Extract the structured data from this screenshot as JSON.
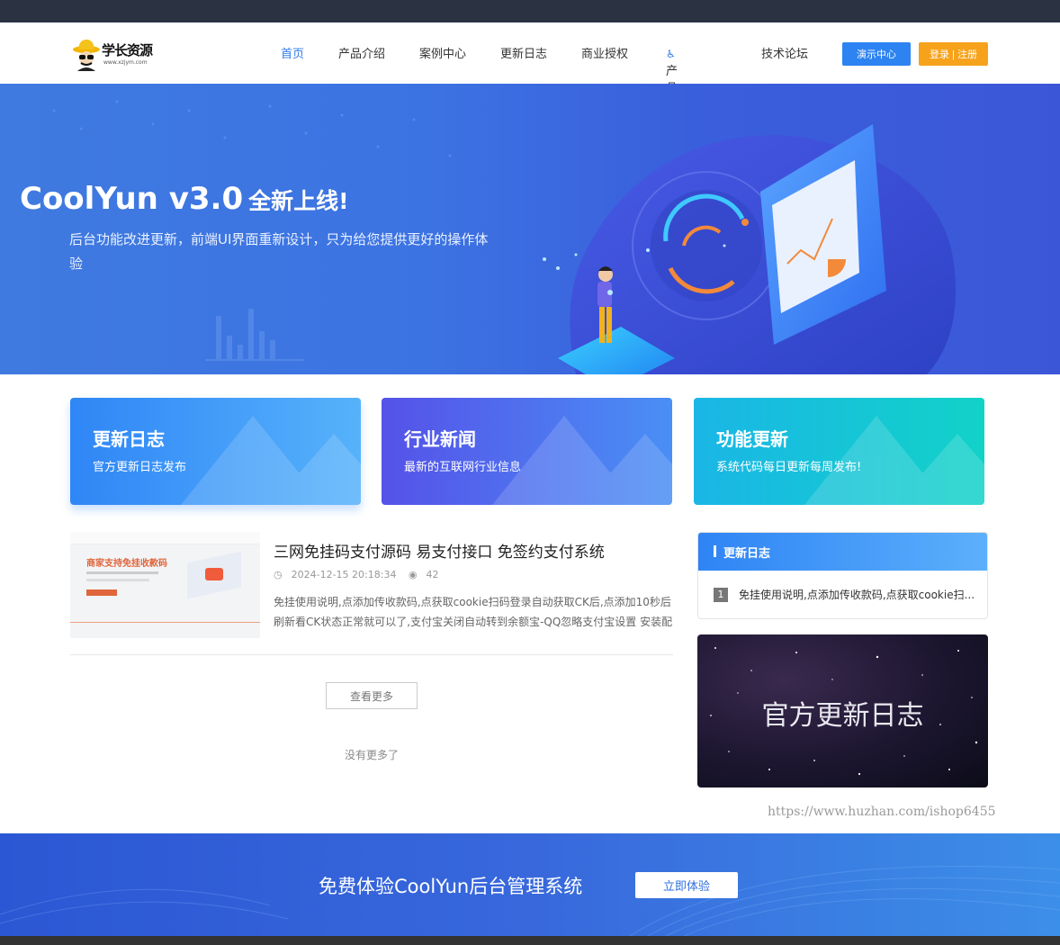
{
  "header": {
    "logo_text": "学长资源",
    "logo_sub": "www.xzjym.com",
    "nav": [
      "首页",
      "产品介绍",
      "案例中心",
      "更新日志",
      "商业授权",
      "产品价格",
      "技术论坛"
    ],
    "demo_label": "演示中心",
    "login_label": "登录 | 注册"
  },
  "banner": {
    "title": "CoolYun v3.0",
    "title_sub": "全新上线!",
    "desc": "后台功能改进更新，前端UI界面重新设计，只为给您提供更好的操作体验"
  },
  "cards": [
    {
      "title": "更新日志",
      "desc": "官方更新日志发布"
    },
    {
      "title": "行业新闻",
      "desc": "最新的互联网行业信息"
    },
    {
      "title": "功能更新",
      "desc": "系统代码每日更新每周发布!"
    }
  ],
  "article": {
    "thumb_title": "商家支持免挂收款码",
    "title": "三网免挂码支付源码 易支付接口 免签约支付系统",
    "date": "2024-12-15 20:18:34",
    "views": "42",
    "desc": "免挂使用说明,点添加传收款码,点获取cookie扫码登录自动获取CK后,点添加10秒后刷新看CK状态正常就可以了,支付宝关闭自动转到余额宝-QQ忽略支付宝设置 安装配"
  },
  "list": {
    "more_label": "查看更多",
    "no_more": "没有更多了"
  },
  "sidebar": {
    "title": "更新日志",
    "items": [
      {
        "num": "1",
        "text": "免挂使用说明,点添加传收款码,点获取cookie扫..."
      }
    ],
    "image_text": "官方更新日志"
  },
  "watermark": "https://www.huzhan.com/ishop6455",
  "cta": {
    "text": "免费体验CoolYun后台管理系统",
    "button": "立即体验"
  },
  "colors": {
    "primary": "#2d83f1",
    "orange": "#f7a21b"
  }
}
